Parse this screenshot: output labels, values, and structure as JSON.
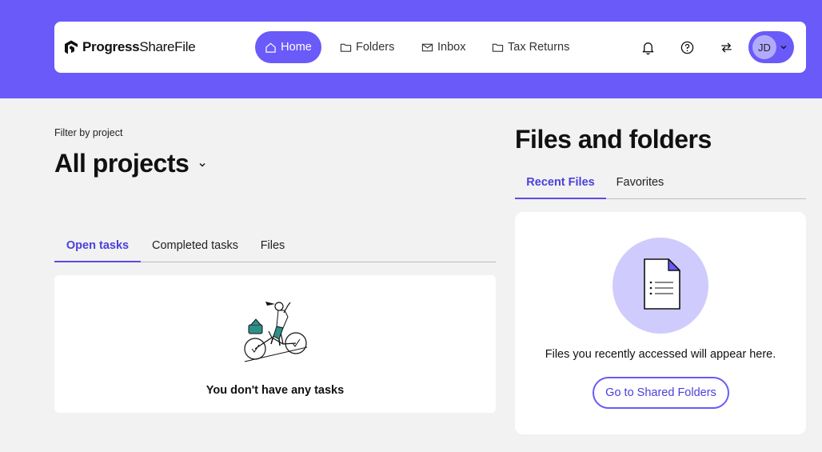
{
  "brand": {
    "name_bold": "Progress",
    "name_regular": "ShareFile",
    "accent_color": "#6a5af9"
  },
  "nav": {
    "items": [
      {
        "label": "Home",
        "icon": "home-icon",
        "active": true
      },
      {
        "label": "Folders",
        "icon": "folder-icon",
        "active": false
      },
      {
        "label": "Inbox",
        "icon": "mail-icon",
        "active": false
      },
      {
        "label": "Tax Returns",
        "icon": "folder-icon",
        "active": false
      }
    ],
    "actions": [
      "bell-icon",
      "help-icon",
      "swap-icon"
    ],
    "account_initials": "JD"
  },
  "projects": {
    "filter_label": "Filter by project",
    "selected": "All projects"
  },
  "tasks": {
    "tabs": [
      {
        "label": "Open tasks",
        "active": true
      },
      {
        "label": "Completed tasks",
        "active": false
      },
      {
        "label": "Files",
        "active": false
      }
    ],
    "empty_message": "You don't have any tasks"
  },
  "files": {
    "title": "Files and folders",
    "tabs": [
      {
        "label": "Recent Files",
        "active": true
      },
      {
        "label": "Favorites",
        "active": false
      }
    ],
    "empty_message": "Files you recently accessed will appear here.",
    "button_label": "Go to Shared Folders"
  }
}
